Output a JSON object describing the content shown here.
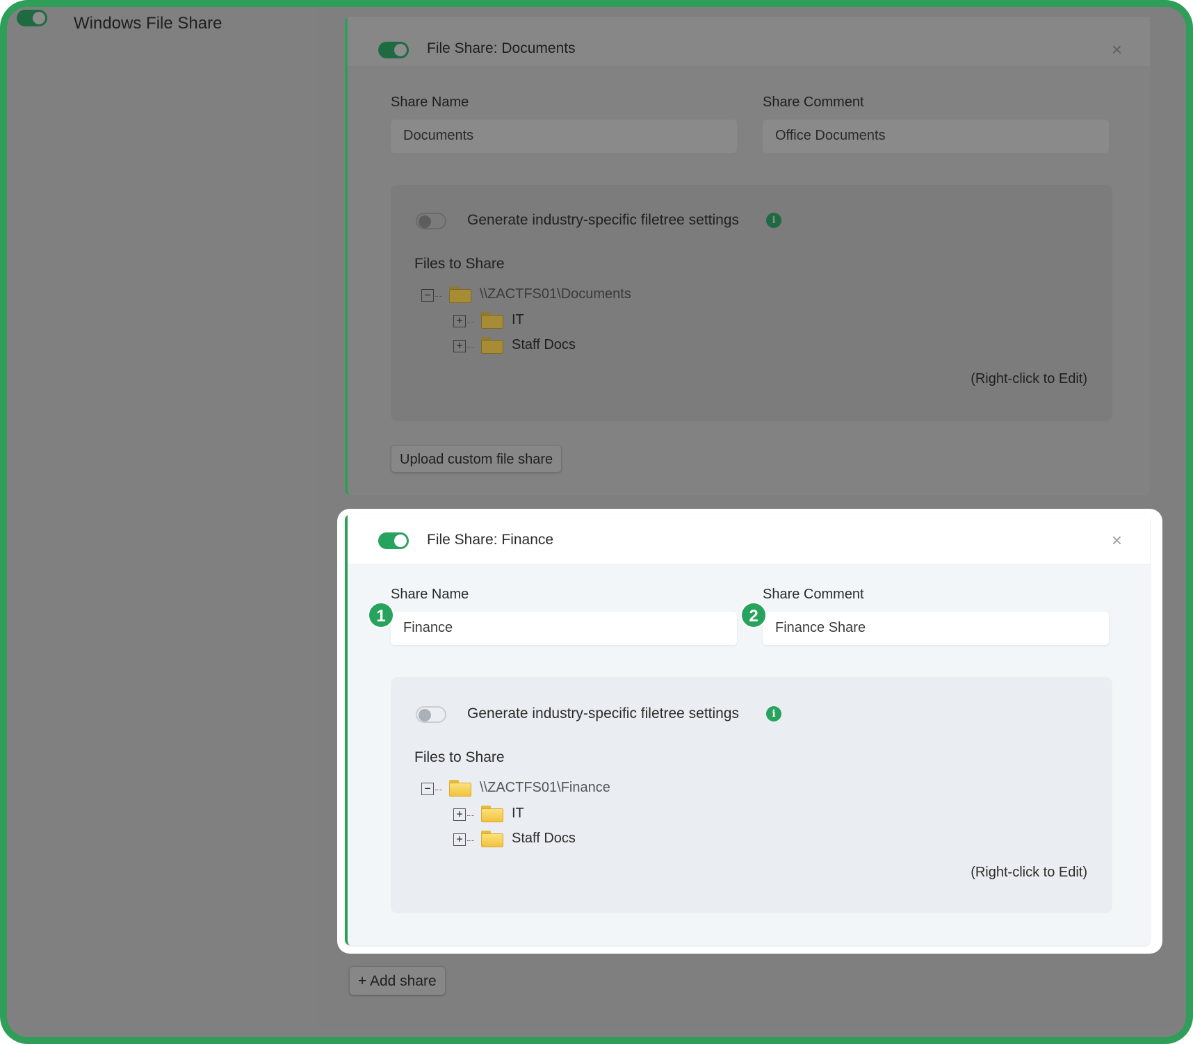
{
  "top": {
    "title": "Windows File Share"
  },
  "shares": [
    {
      "title": "File Share: Documents",
      "share_name_label": "Share Name",
      "share_name_value": "Documents",
      "share_comment_label": "Share Comment",
      "share_comment_value": "Office Documents",
      "generate_label": "Generate industry-specific filetree settings",
      "files_label": "Files to Share",
      "tree": {
        "root": "\\\\ZACTFS01\\Documents",
        "children": [
          "IT",
          "Staff Docs"
        ]
      },
      "right_click_hint": "(Right-click to Edit)",
      "upload_label": "Upload custom file share"
    },
    {
      "title": "File Share: Finance",
      "share_name_label": "Share Name",
      "share_name_value": "Finance",
      "share_comment_label": "Share Comment",
      "share_comment_value": "Finance Share",
      "generate_label": "Generate industry-specific filetree settings",
      "files_label": "Files to Share",
      "tree": {
        "root": "\\\\ZACTFS01\\Finance",
        "children": [
          "IT",
          "Staff Docs"
        ]
      },
      "right_click_hint": "(Right-click to Edit)"
    }
  ],
  "badges": [
    "1",
    "2"
  ],
  "add_share_label": "+ Add share",
  "icons": {
    "close": "×",
    "info": "i",
    "expand": "+",
    "collapse": "−"
  },
  "colors": {
    "accent": "#27a35d",
    "frame": "#2e9e58"
  }
}
